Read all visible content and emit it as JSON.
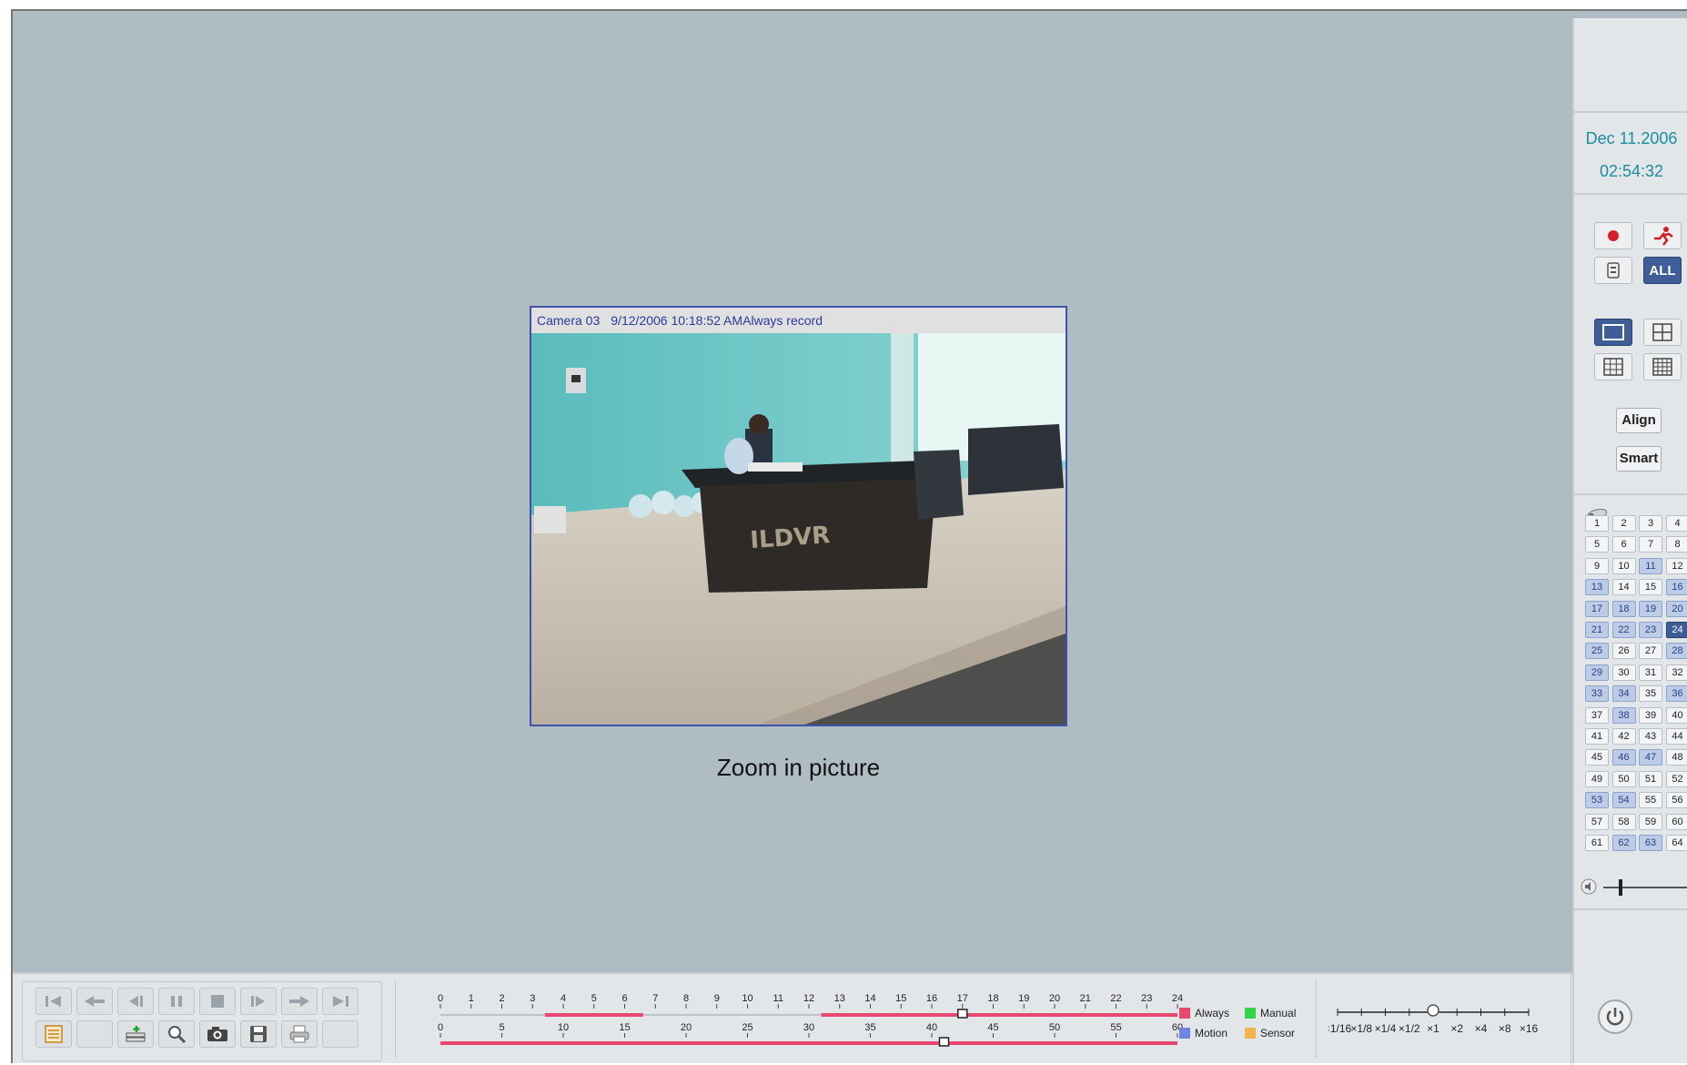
{
  "video": {
    "camera": "Camera 03",
    "datetime": "9/12/2006 10:18:52 AM",
    "record_mode": "Always record",
    "scene_text": "ILDVR",
    "caption": "Zoom in picture"
  },
  "clock": {
    "date": "Dec 11.2006",
    "time": "02:54:32"
  },
  "right_panel": {
    "all_label": "ALL",
    "align_label": "Align",
    "smart_label": "Smart",
    "cameras": [
      {
        "n": "1",
        "s": "normal"
      },
      {
        "n": "2",
        "s": "normal"
      },
      {
        "n": "3",
        "s": "normal"
      },
      {
        "n": "4",
        "s": "normal"
      },
      {
        "n": "5",
        "s": "normal"
      },
      {
        "n": "6",
        "s": "normal"
      },
      {
        "n": "7",
        "s": "normal"
      },
      {
        "n": "8",
        "s": "normal"
      },
      {
        "n": "9",
        "s": "normal"
      },
      {
        "n": "10",
        "s": "normal"
      },
      {
        "n": "11",
        "s": "active"
      },
      {
        "n": "12",
        "s": "normal"
      },
      {
        "n": "13",
        "s": "active"
      },
      {
        "n": "14",
        "s": "normal"
      },
      {
        "n": "15",
        "s": "normal"
      },
      {
        "n": "16",
        "s": "active"
      },
      {
        "n": "17",
        "s": "active"
      },
      {
        "n": "18",
        "s": "active"
      },
      {
        "n": "19",
        "s": "active"
      },
      {
        "n": "20",
        "s": "active"
      },
      {
        "n": "21",
        "s": "active"
      },
      {
        "n": "22",
        "s": "active"
      },
      {
        "n": "23",
        "s": "active"
      },
      {
        "n": "24",
        "s": "selected"
      },
      {
        "n": "25",
        "s": "active"
      },
      {
        "n": "26",
        "s": "normal"
      },
      {
        "n": "27",
        "s": "normal"
      },
      {
        "n": "28",
        "s": "active"
      },
      {
        "n": "29",
        "s": "active"
      },
      {
        "n": "30",
        "s": "normal"
      },
      {
        "n": "31",
        "s": "normal"
      },
      {
        "n": "32",
        "s": "normal"
      },
      {
        "n": "33",
        "s": "active"
      },
      {
        "n": "34",
        "s": "active"
      },
      {
        "n": "35",
        "s": "normal"
      },
      {
        "n": "36",
        "s": "active"
      },
      {
        "n": "37",
        "s": "normal"
      },
      {
        "n": "38",
        "s": "active"
      },
      {
        "n": "39",
        "s": "normal"
      },
      {
        "n": "40",
        "s": "normal"
      },
      {
        "n": "41",
        "s": "normal"
      },
      {
        "n": "42",
        "s": "normal"
      },
      {
        "n": "43",
        "s": "normal"
      },
      {
        "n": "44",
        "s": "normal"
      },
      {
        "n": "45",
        "s": "normal"
      },
      {
        "n": "46",
        "s": "active"
      },
      {
        "n": "47",
        "s": "active"
      },
      {
        "n": "48",
        "s": "normal"
      },
      {
        "n": "49",
        "s": "normal"
      },
      {
        "n": "50",
        "s": "normal"
      },
      {
        "n": "51",
        "s": "normal"
      },
      {
        "n": "52",
        "s": "normal"
      },
      {
        "n": "53",
        "s": "active"
      },
      {
        "n": "54",
        "s": "active"
      },
      {
        "n": "55",
        "s": "normal"
      },
      {
        "n": "56",
        "s": "normal"
      },
      {
        "n": "57",
        "s": "normal"
      },
      {
        "n": "58",
        "s": "normal"
      },
      {
        "n": "59",
        "s": "normal"
      },
      {
        "n": "60",
        "s": "normal"
      },
      {
        "n": "61",
        "s": "normal"
      },
      {
        "n": "62",
        "s": "active"
      },
      {
        "n": "63",
        "s": "active"
      },
      {
        "n": "64",
        "s": "normal"
      }
    ],
    "volume_level": 0.18
  },
  "timeline": {
    "hour_labels": [
      "0",
      "1",
      "2",
      "3",
      "4",
      "5",
      "6",
      "7",
      "8",
      "9",
      "10",
      "11",
      "12",
      "13",
      "14",
      "15",
      "16",
      "17",
      "18",
      "19",
      "20",
      "21",
      "22",
      "23",
      "24"
    ],
    "hour_records": [
      [
        3.4,
        6.6
      ],
      [
        12.4,
        24
      ]
    ],
    "hour_cursor": 17,
    "minute_labels": [
      "0",
      "5",
      "10",
      "15",
      "20",
      "25",
      "30",
      "35",
      "40",
      "45",
      "50",
      "55",
      "60"
    ],
    "minute_records": [
      [
        0,
        60
      ]
    ],
    "minute_cursor": 41
  },
  "legend": {
    "always": "Always",
    "manual": "Manual",
    "motion": "Motion",
    "sensor": "Sensor"
  },
  "colors": {
    "always": "#e8476f",
    "manual": "#33d44a",
    "motion": "#6f83e0",
    "sensor": "#f2b24c"
  },
  "speed": {
    "labels": [
      "×1/16",
      "×1/8",
      "×1/4",
      "×1/2",
      "×1",
      "×2",
      "×4",
      "×8",
      "×16"
    ],
    "current": "×1"
  }
}
